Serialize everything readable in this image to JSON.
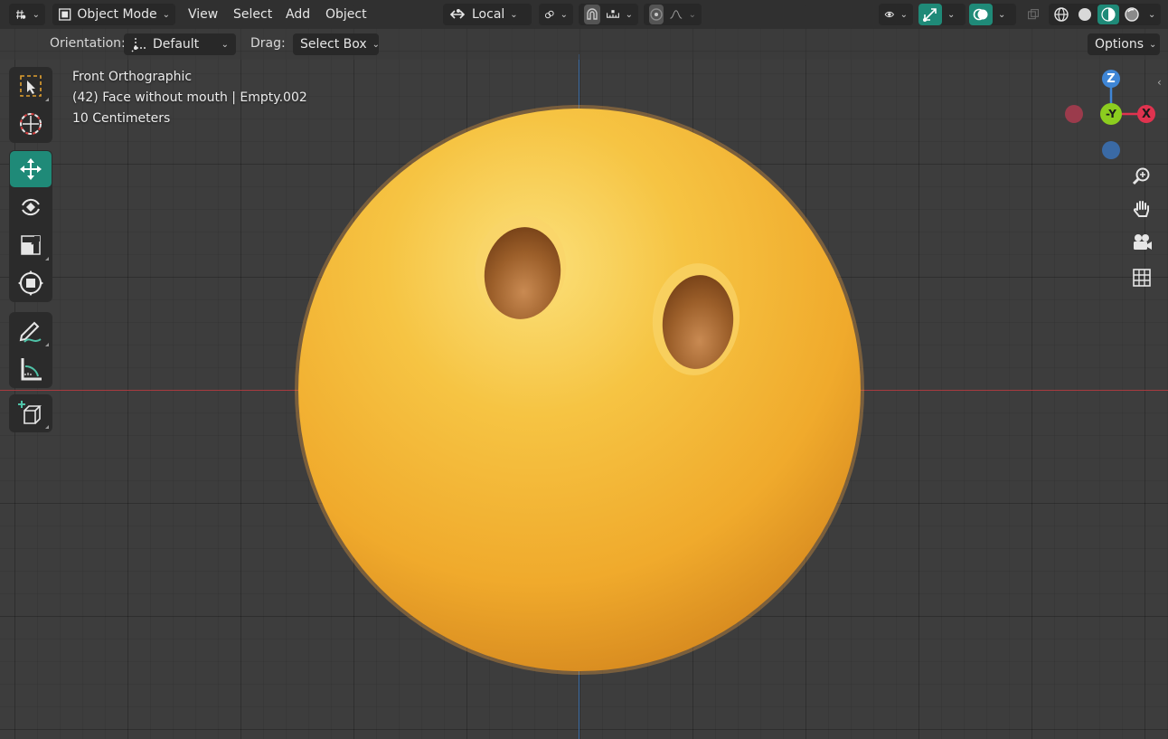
{
  "header": {
    "editor_type_icon": "viewport-icon",
    "mode": "Object Mode",
    "menu": [
      "View",
      "Select",
      "Add",
      "Object"
    ],
    "pivot": "Local",
    "pivot_icon": "transform-orientation-icon",
    "snap_icon": "link-icon",
    "shading_modes": [
      "wireframe",
      "solid",
      "material",
      "rendered"
    ]
  },
  "tool_settings": {
    "orientation_label": "Orientation:",
    "orientation_value": "Default",
    "drag_label": "Drag:",
    "drag_value": "Select Box",
    "options_label": "Options"
  },
  "overlay_text": {
    "view_name": "Front Orthographic",
    "object_info": "(42) Face without mouth | Empty.002",
    "scale": "10 Centimeters"
  },
  "toolbar": {
    "groups": [
      [
        "select-box",
        "cursor"
      ],
      [
        "move",
        "rotate",
        "scale",
        "transform"
      ],
      [
        "annotate",
        "measure"
      ],
      [
        "add-cube"
      ]
    ],
    "active_tool": "move"
  },
  "gizmo": {
    "z_label": "Z",
    "y_label": "-Y",
    "x_label": "X",
    "colors": {
      "x": "#e0334f",
      "y": "#8ccd1f",
      "z": "#3f86d6"
    }
  },
  "colors": {
    "accent": "#1f8a78",
    "emoji_base": "#f6b633"
  }
}
